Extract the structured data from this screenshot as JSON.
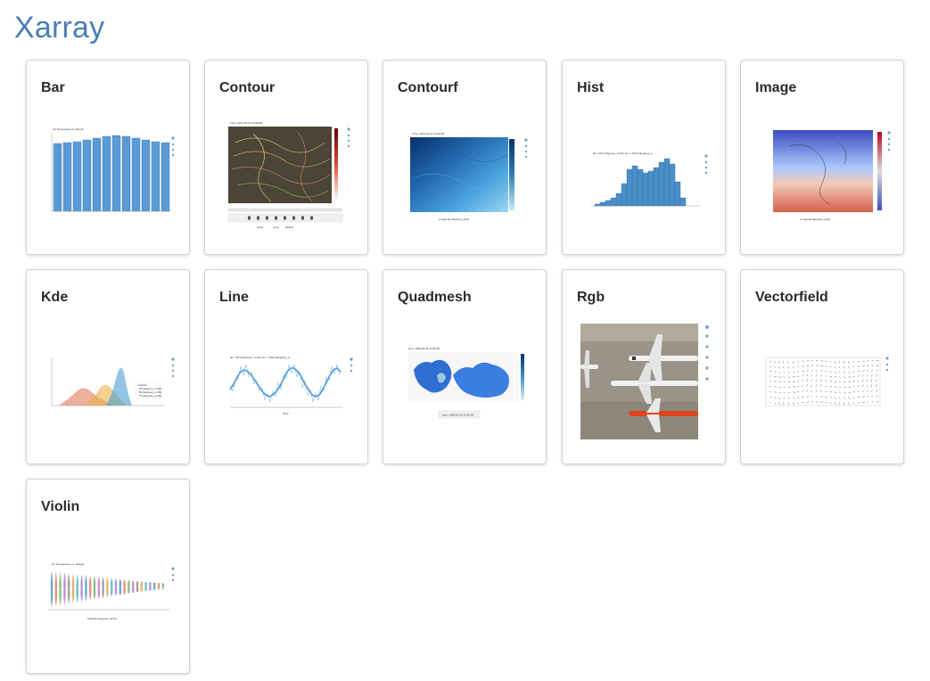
{
  "page": {
    "title": "Xarray"
  },
  "cards": [
    {
      "label": "Bar",
      "thumb": {
        "title": "Air Temperature by Month"
      }
    },
    {
      "label": "Contour",
      "thumb": {
        "title": "Time: 2013-01-01 00:00:00",
        "controls": [
          "Once",
          "Loop",
          "Reflect"
        ]
      }
    },
    {
      "label": "Contourf",
      "thumb": {
        "title": "Time: 2013-01-01 00:00:00",
        "xlabel": "Longitude [degrees_east]"
      }
    },
    {
      "label": "Hist",
      "thumb": {
        "title": "lat = 90.0 [degrees_north], lon = 200.0 [degrees_e..."
      }
    },
    {
      "label": "Image",
      "thumb": {
        "xlabel": "Longitude [degrees_east]"
      }
    },
    {
      "label": "Kde",
      "thumb": {
        "legend": [
          "Latitude",
          "25 [degrees_north]",
          "50 [degrees_north]",
          "75 [degrees_north]"
        ]
      }
    },
    {
      "label": "Line",
      "thumb": {
        "title": "lat = 90.0 [degrees_north], lon = 200.0 [degrees_e...",
        "xlabel": "Time"
      }
    },
    {
      "label": "Quadmesh",
      "thumb": {
        "title": "time: 1999-09-15 12:00:00"
      }
    },
    {
      "label": "Rgb",
      "thumb": {}
    },
    {
      "label": "Vectorfield",
      "thumb": {}
    },
    {
      "label": "Violin",
      "thumb": {
        "title": "Air Temperature vs. latitude",
        "xlabel": "Latitude [degrees_north]"
      }
    }
  ],
  "colors": {
    "title": "#4a7db3",
    "bar_fill": "#5a9bd5",
    "accent_red": "#b2182b"
  }
}
